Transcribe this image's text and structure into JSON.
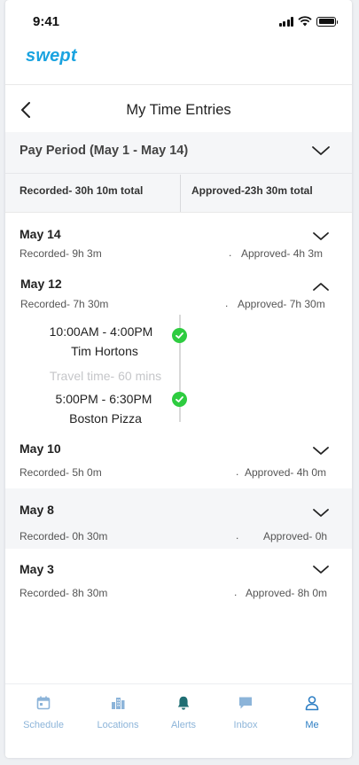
{
  "status_bar": {
    "time": "9:41"
  },
  "brand": {
    "logo_text": "swept"
  },
  "header": {
    "title": "My Time Entries"
  },
  "pay_period": {
    "title": "Pay Period (May 1 - May 14)",
    "recorded": "Recorded- 30h 10m total",
    "approved": "Approved-23h 30m total"
  },
  "days": [
    {
      "date": "May 14",
      "recorded": "Recorded- 9h 3m",
      "dot": ".",
      "approved": "Approved- 4h 3m",
      "expanded": false
    },
    {
      "date": "May 12",
      "recorded": "Recorded- 7h 30m",
      "dot": ".",
      "approved": "Approved- 7h 30m",
      "expanded": true,
      "entries": [
        {
          "time": "10:00AM - 4:00PM",
          "location": "Tim Hortons"
        },
        {
          "time": "5:00PM - 6:30PM",
          "location": "Boston Pizza"
        }
      ],
      "travel": "Travel time- 60 mins"
    },
    {
      "date": "May 10",
      "recorded": "Recorded- 5h 0m",
      "dot": ".",
      "approved": "Approved- 4h 0m",
      "expanded": false
    },
    {
      "date": "May 8",
      "recorded": "Recorded- 0h 30m",
      "dot": ".",
      "approved": "Approved- 0h",
      "expanded": false
    },
    {
      "date": "May 3",
      "recorded": "Recorded- 8h 30m",
      "dot": ".",
      "approved": "Approved- 8h 0m",
      "expanded": false
    }
  ],
  "tabs": [
    {
      "label": "Schedule",
      "icon": "calendar-icon"
    },
    {
      "label": "Locations",
      "icon": "buildings-icon"
    },
    {
      "label": "Alerts",
      "icon": "bell-icon"
    },
    {
      "label": "Inbox",
      "icon": "chat-icon"
    },
    {
      "label": "Me",
      "icon": "user-icon",
      "active": true
    }
  ],
  "colors": {
    "brand": "#1aa3e0",
    "check": "#2ecc40",
    "tab_inactive": "#8cb4d9",
    "tab_active": "#2f7fc4",
    "alerts_icon": "#1f6e73"
  }
}
